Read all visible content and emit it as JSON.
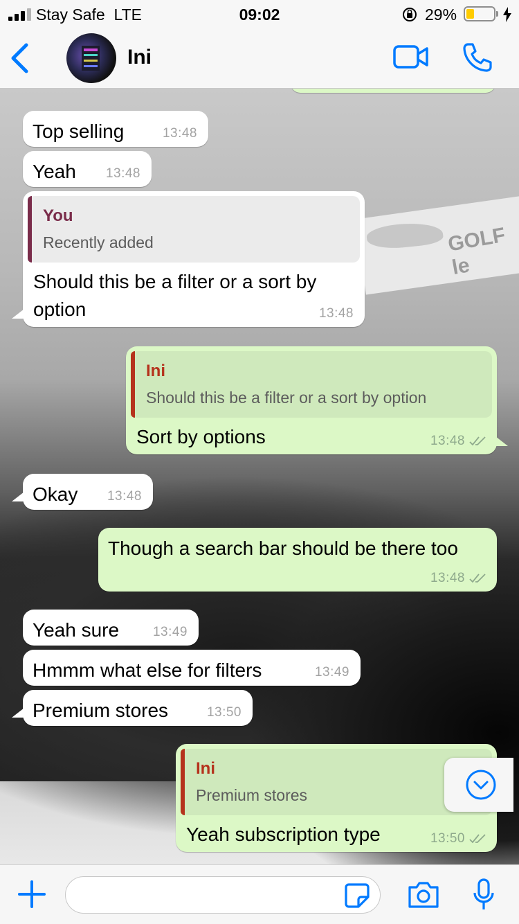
{
  "status_bar": {
    "carrier": "Stay Safe",
    "network": "LTE",
    "time": "09:02",
    "battery_percent": "29%",
    "battery_level": 0.29,
    "battery_color": "#ffcc00"
  },
  "header": {
    "back_icon": "chevron-left-icon",
    "contact_name": "Ini",
    "accent_color": "#007aff"
  },
  "colors": {
    "incoming_bubble": "#ffffff",
    "outgoing_bubble": "#dcf8c6",
    "reply_name_you": "#7a2c4a",
    "reply_name_ini": "#b5321c"
  },
  "messages": [
    {
      "id": "m0",
      "dir": "out",
      "partial": true
    },
    {
      "id": "m1",
      "dir": "in",
      "text": "Top selling",
      "time": "13:48"
    },
    {
      "id": "m2",
      "dir": "in",
      "text": "Yeah",
      "time": "13:48"
    },
    {
      "id": "m3",
      "dir": "in",
      "reply": {
        "name": "You",
        "text": "Recently added"
      },
      "text": "Should this be a filter or a sort by option",
      "time": "13:48"
    },
    {
      "id": "m4",
      "dir": "out",
      "reply": {
        "name": "Ini",
        "text": "Should this be a filter or a sort by option"
      },
      "text": "Sort by options",
      "time": "13:48",
      "status": "read"
    },
    {
      "id": "m5",
      "dir": "in",
      "text": "Okay",
      "time": "13:48"
    },
    {
      "id": "m6",
      "dir": "out",
      "text": "Though a search bar should be there too",
      "time": "13:48",
      "status": "read"
    },
    {
      "id": "m7",
      "dir": "in",
      "text": "Yeah sure",
      "time": "13:49"
    },
    {
      "id": "m8",
      "dir": "in",
      "text": "Hmmm what else for filters",
      "time": "13:49"
    },
    {
      "id": "m9",
      "dir": "in",
      "text": "Premium stores",
      "time": "13:50"
    },
    {
      "id": "m10",
      "dir": "out",
      "reply": {
        "name": "Ini",
        "text": "Premium stores"
      },
      "text": "Yeah subscription type",
      "time": "13:50",
      "status": "read"
    }
  ],
  "wallpaper_text": "GOLF le",
  "input": {
    "value": "",
    "placeholder": ""
  }
}
